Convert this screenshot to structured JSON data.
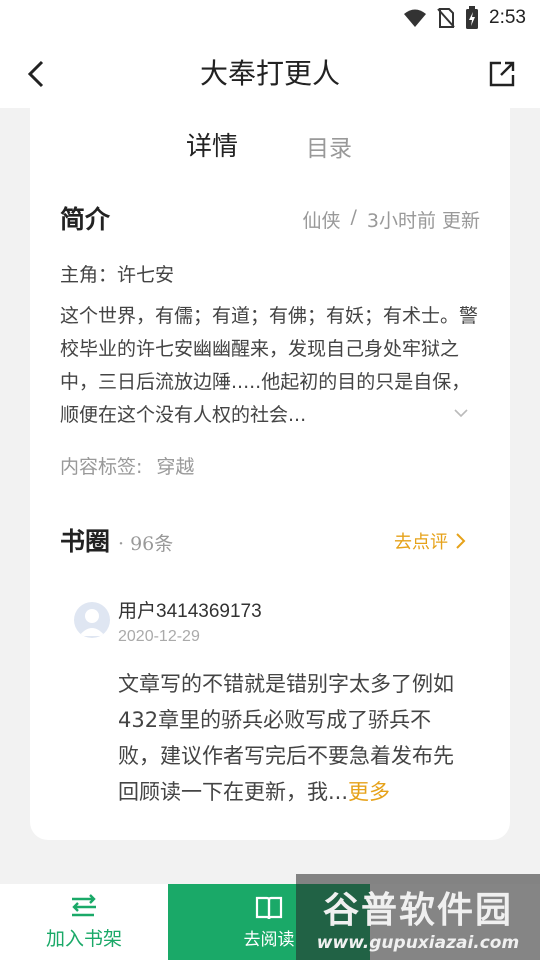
{
  "status_bar": {
    "time": "2:53"
  },
  "header": {
    "title": "大奉打更人"
  },
  "tabs": [
    {
      "label": "详情"
    },
    {
      "label": "目录"
    }
  ],
  "intro": {
    "title": "简介",
    "category": "仙侠",
    "separator": "/",
    "updated": "3小时前 更新",
    "protagonist": "主角：许七安",
    "synopsis": "这个世界，有儒；有道；有佛；有妖；有术士。警校毕业的许七安幽幽醒来，发现自己身处牢狱之中，三日后流放边陲.....他起初的目的只是自保，顺便在这个没有人权的社会...",
    "tags_label": "内容标签:",
    "tags": [
      "穿越"
    ]
  },
  "circle": {
    "title": "书圈",
    "count": "· 96条",
    "review_link": "去点评"
  },
  "post": {
    "username": "用户3414369173",
    "date": "2020-12-29",
    "text": "文章写的不错就是错别字太多了例如432章里的骄兵必败写成了骄兵不败，建议作者写完后不要急着发布先回顾读一下在更新，我...",
    "more": "更多"
  },
  "bottom_bar": {
    "shelf_label": "加入书架",
    "read_label": "去阅读"
  },
  "watermark": {
    "line1": "谷普软件园",
    "line2": "www.gupuxiazai.com"
  },
  "colors": {
    "accent_green": "#1aa968",
    "accent_orange": "#e6a21a"
  }
}
